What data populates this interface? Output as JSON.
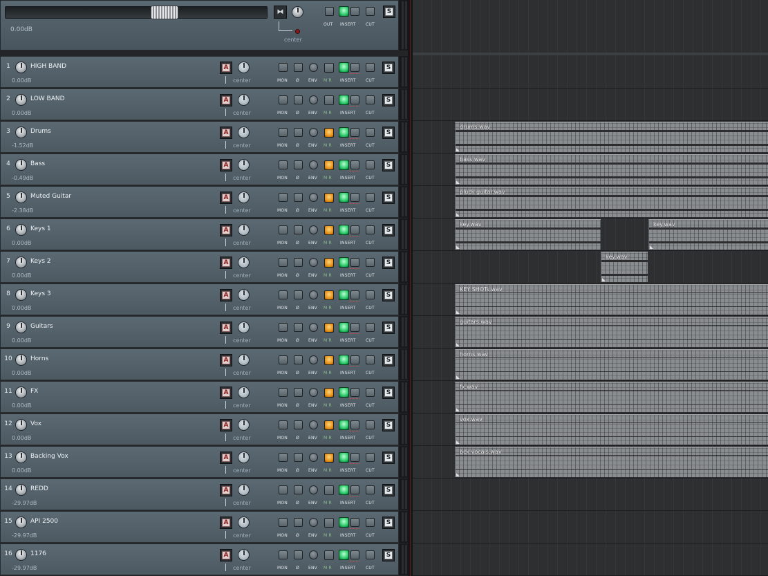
{
  "master": {
    "volume": "0.00dB",
    "pan": "center",
    "labels": {
      "out": "OUT",
      "insert": "INSERT",
      "cut": "CUT"
    },
    "solo_label": "S",
    "mono_stereo_glyph": "⧓"
  },
  "track_labels": {
    "arm": "A",
    "solo": "S",
    "pan": "center",
    "mon": "MON",
    "phase": "Ø",
    "env": "ENV",
    "mr": "M R",
    "insert": "INSERT",
    "cut": "CUT"
  },
  "tracks": [
    {
      "num": "1",
      "name": "HIGH BAND",
      "volume": "0.00dB",
      "mr_lit": false
    },
    {
      "num": "2",
      "name": "LOW BAND",
      "volume": "0.00dB",
      "mr_lit": false
    },
    {
      "num": "3",
      "name": "Drums",
      "volume": "-1.52dB",
      "mr_lit": true
    },
    {
      "num": "4",
      "name": "Bass",
      "volume": "-0.49dB",
      "mr_lit": true
    },
    {
      "num": "5",
      "name": "Muted Guitar",
      "volume": "-2.38dB",
      "mr_lit": true
    },
    {
      "num": "6",
      "name": "Keys 1",
      "volume": "0.00dB",
      "mr_lit": true
    },
    {
      "num": "7",
      "name": "Keys 2",
      "volume": "0.00dB",
      "mr_lit": true
    },
    {
      "num": "8",
      "name": "Keys 3",
      "volume": "0.00dB",
      "mr_lit": true
    },
    {
      "num": "9",
      "name": "Guitars",
      "volume": "0.00dB",
      "mr_lit": true
    },
    {
      "num": "10",
      "name": "Horns",
      "volume": "0.00dB",
      "mr_lit": true
    },
    {
      "num": "11",
      "name": "FX",
      "volume": "0.00dB",
      "mr_lit": true
    },
    {
      "num": "12",
      "name": "Vox",
      "volume": "0.00dB",
      "mr_lit": true
    },
    {
      "num": "13",
      "name": "Backing Vox",
      "volume": "0.00dB",
      "mr_lit": true
    },
    {
      "num": "14",
      "name": "REDD",
      "volume": "-29.97dB",
      "mr_lit": false
    },
    {
      "num": "15",
      "name": "API 2500",
      "volume": "-29.97dB",
      "mr_lit": false
    },
    {
      "num": "16",
      "name": "1176",
      "volume": "-29.97dB",
      "mr_lit": false
    }
  ],
  "items": [
    {
      "track": 3,
      "name": "drums.wav"
    },
    {
      "track": 4,
      "name": "bass.wav"
    },
    {
      "track": 5,
      "name": "pluck guitar.wav"
    },
    {
      "track": 6,
      "name": "key.wav"
    },
    {
      "track": 6,
      "name": "key.wav"
    },
    {
      "track": 7,
      "name": "key.wav"
    },
    {
      "track": 8,
      "name": "KEY SHOTs.wav"
    },
    {
      "track": 9,
      "name": "guitars.wav"
    },
    {
      "track": 10,
      "name": "horns.wav"
    },
    {
      "track": 11,
      "name": "fx.wav"
    },
    {
      "track": 12,
      "name": "vox.wav"
    },
    {
      "track": 13,
      "name": "bck vocals.wav"
    }
  ]
}
